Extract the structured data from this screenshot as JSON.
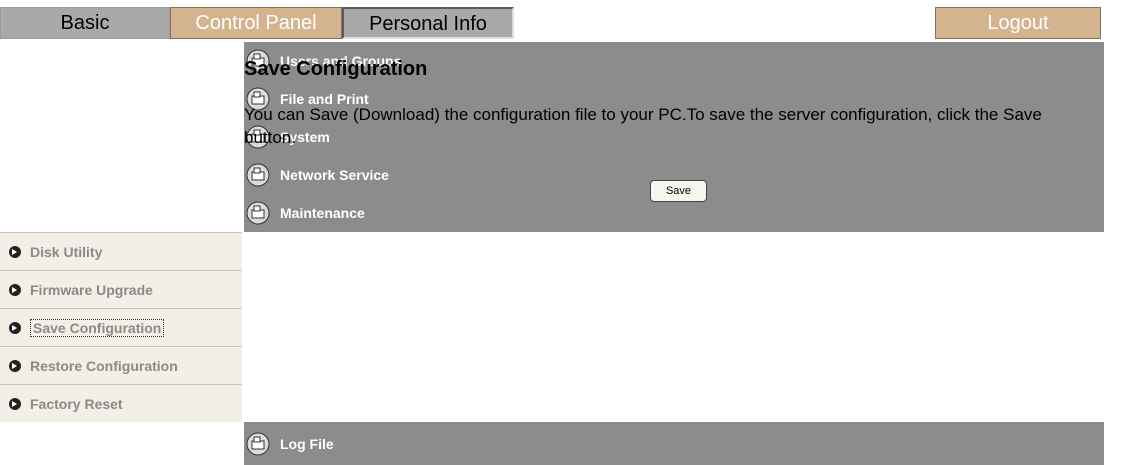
{
  "topbar": {
    "tabs": [
      "Basic",
      "Control Panel",
      "Personal Info"
    ],
    "logout_label": "Logout"
  },
  "sidebar": {
    "items": [
      {
        "label": "Users and Groups",
        "type": "main",
        "icon": "folder-icon"
      },
      {
        "label": "File and Print",
        "type": "main",
        "icon": "folder-icon"
      },
      {
        "label": "System",
        "type": "main",
        "icon": "folder-icon"
      },
      {
        "label": "Network Service",
        "type": "main",
        "icon": "folder-icon"
      },
      {
        "label": "Maintenance",
        "type": "main",
        "icon": "folder-icon"
      },
      {
        "label": "Disk Utility",
        "type": "sub",
        "icon": "bullet-arrow-icon"
      },
      {
        "label": "Firmware Upgrade",
        "type": "sub",
        "icon": "bullet-arrow-icon"
      },
      {
        "label": "Save Configuration",
        "type": "sub",
        "icon": "bullet-arrow-icon",
        "active": true
      },
      {
        "label": "Restore Configuration",
        "type": "sub",
        "icon": "bullet-arrow-icon"
      },
      {
        "label": "Factory Reset",
        "type": "sub",
        "icon": "bullet-arrow-icon"
      },
      {
        "label": "Log File",
        "type": "main",
        "icon": "folder-icon"
      }
    ]
  },
  "main": {
    "title": "Save Configuration",
    "description": "You can Save (Download) the configuration file to your PC.To save the server configuration, click the Save button.",
    "save_label": "Save"
  },
  "colors": {
    "accent_tan": "#d4b48e",
    "tab_gray": "#a9a9a9",
    "sidebar_main": "#8c8c8c",
    "sidebar_sub": "#f4efe6"
  }
}
